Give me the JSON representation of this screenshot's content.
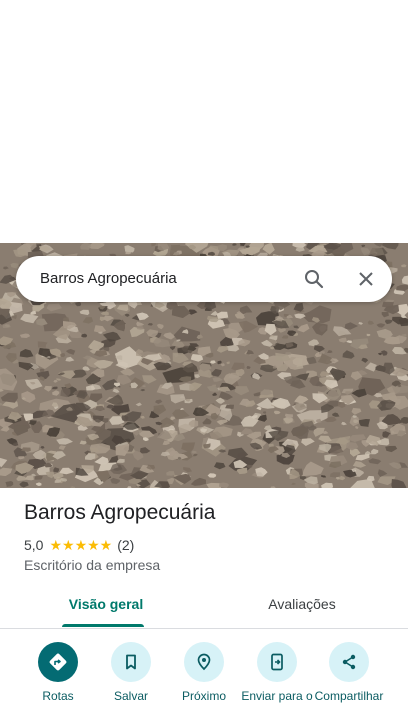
{
  "search": {
    "query": "Barros Agropecuária"
  },
  "place": {
    "name": "Barros Agropecuária",
    "rating": "5,0",
    "stars": "★★★★★",
    "review_count": "(2)",
    "category": "Escritório da empresa"
  },
  "tabs": [
    {
      "label": "Visão geral",
      "selected": true
    },
    {
      "label": "Avaliações",
      "selected": false
    }
  ],
  "actions": [
    {
      "label": "Rotas",
      "icon": "directions-icon"
    },
    {
      "label": "Salvar",
      "icon": "bookmark-icon"
    },
    {
      "label": "Próximo",
      "icon": "nearby-icon"
    },
    {
      "label": "Enviar para o",
      "icon": "send-to-phone-icon"
    },
    {
      "label": "Compartilhar",
      "icon": "share-icon"
    }
  ],
  "colors": {
    "accent": "#00796b",
    "action_bg": "#d7f2f7",
    "primary_action_bg": "#046b73",
    "star": "#fbbc04"
  }
}
